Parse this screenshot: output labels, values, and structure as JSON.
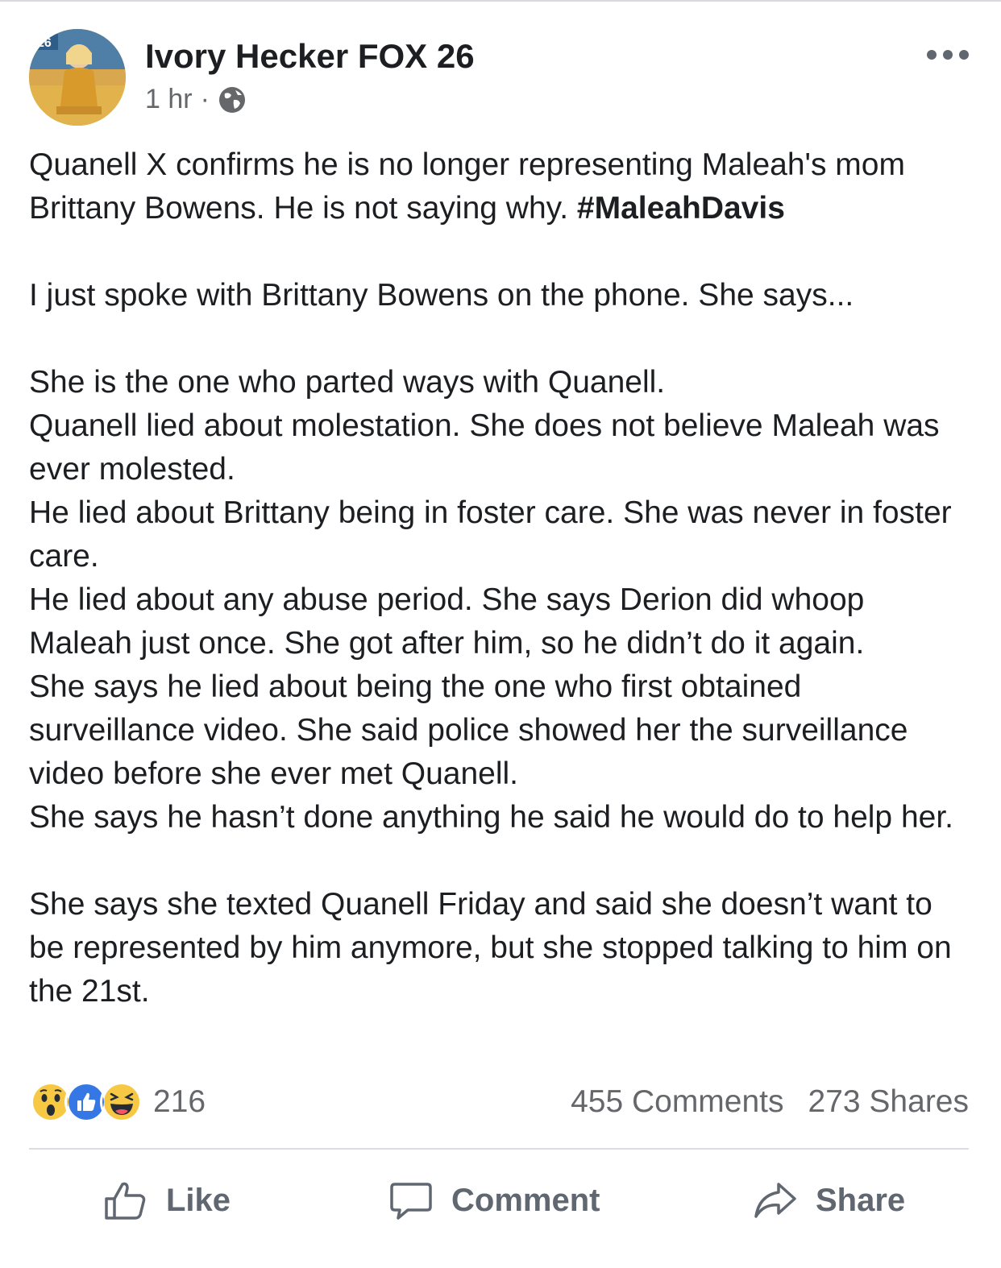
{
  "post": {
    "author": "Ivory Hecker FOX 26",
    "time": "1 hr",
    "separator": "·",
    "privacy_icon": "globe-icon",
    "avatar_badge": "26",
    "paragraphs": [
      {
        "text": "Quanell X confirms he is no longer representing Maleah's mom Brittany Bowens. He is not saying why. ",
        "hashtag": "#MaleahDavis"
      },
      {
        "text": "I just spoke with Brittany Bowens on the phone. She says..."
      },
      {
        "lines": [
          "She is the one who parted ways with Quanell.",
          "Quanell lied about molestation. She does not believe Maleah was ever molested.",
          "He lied about Brittany being in foster care. She was never in foster care.",
          "He lied about any abuse period. She says Derion did whoop Maleah just once. She got after him, so he didn’t do it again.",
          "She says he lied about being the one who first obtained surveillance video. She said police showed her the surveillance video before she ever met Quanell.",
          "She says he hasn’t done anything he said he would do to help her."
        ]
      },
      {
        "text": "She says she texted Quanell Friday and said she doesn’t want to be represented by him anymore, but she stopped talking to him on the 21st."
      }
    ]
  },
  "stats": {
    "reaction_icons": [
      "wow-icon",
      "like-icon",
      "haha-icon"
    ],
    "reaction_count": "216",
    "comments": "455 Comments",
    "shares": "273 Shares"
  },
  "actions": {
    "like": "Like",
    "comment": "Comment",
    "share": "Share"
  },
  "colors": {
    "text": "#1c1e21",
    "secondary": "#65676b",
    "like_blue": "#3578e5",
    "reaction_yellow": "#f7c844"
  }
}
